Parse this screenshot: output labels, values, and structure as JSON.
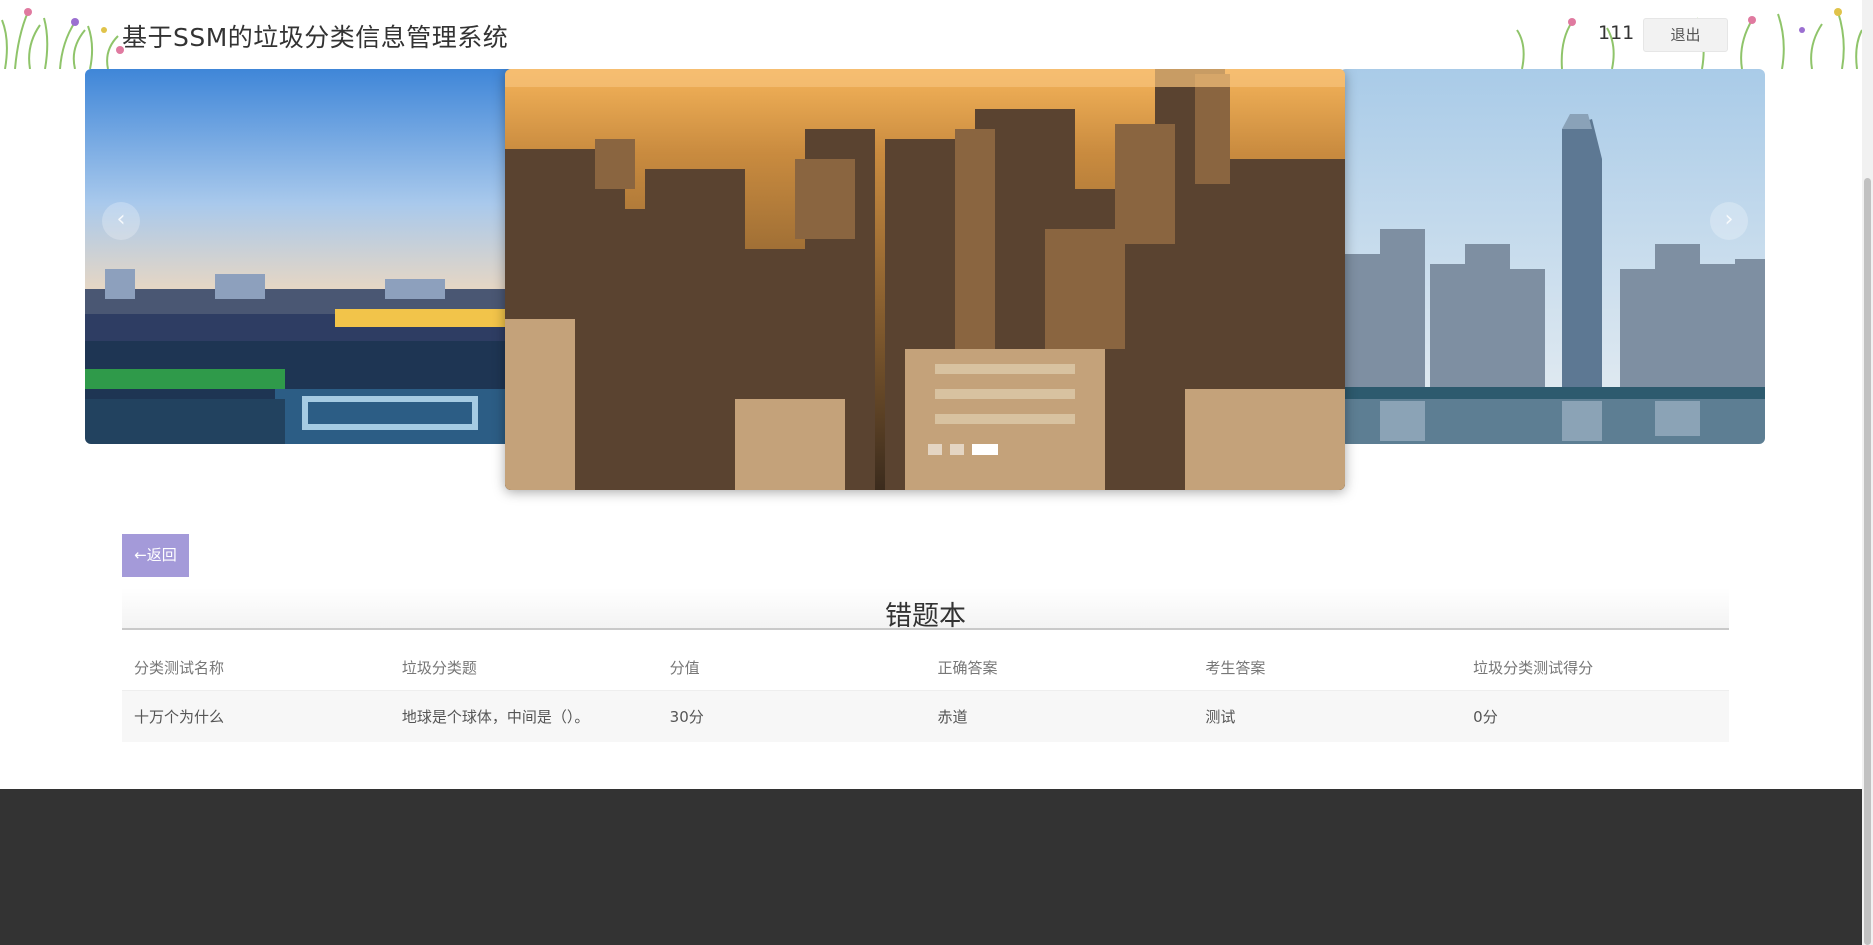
{
  "header": {
    "title": "基于SSM的垃圾分类信息管理系统",
    "username": "111",
    "logout_label": "退出"
  },
  "carousel": {
    "prev_icon": "chevron-left-icon",
    "next_icon": "chevron-right-icon",
    "prev_glyph": "‹",
    "next_glyph": "›",
    "slide_count": 3,
    "active_index": 2
  },
  "content": {
    "back_label": "←返回",
    "section_title": "错题本",
    "table": {
      "columns": [
        "分类测试名称",
        "垃圾分类题",
        "分值",
        "正确答案",
        "考生答案",
        "垃圾分类测试得分"
      ],
      "rows": [
        [
          "十万个为什么",
          "地球是个球体，中间是（）。",
          "30分",
          "赤道",
          "测试",
          "0分"
        ]
      ]
    }
  },
  "colors": {
    "back_button": "#a49ad9",
    "footer": "#333333"
  }
}
